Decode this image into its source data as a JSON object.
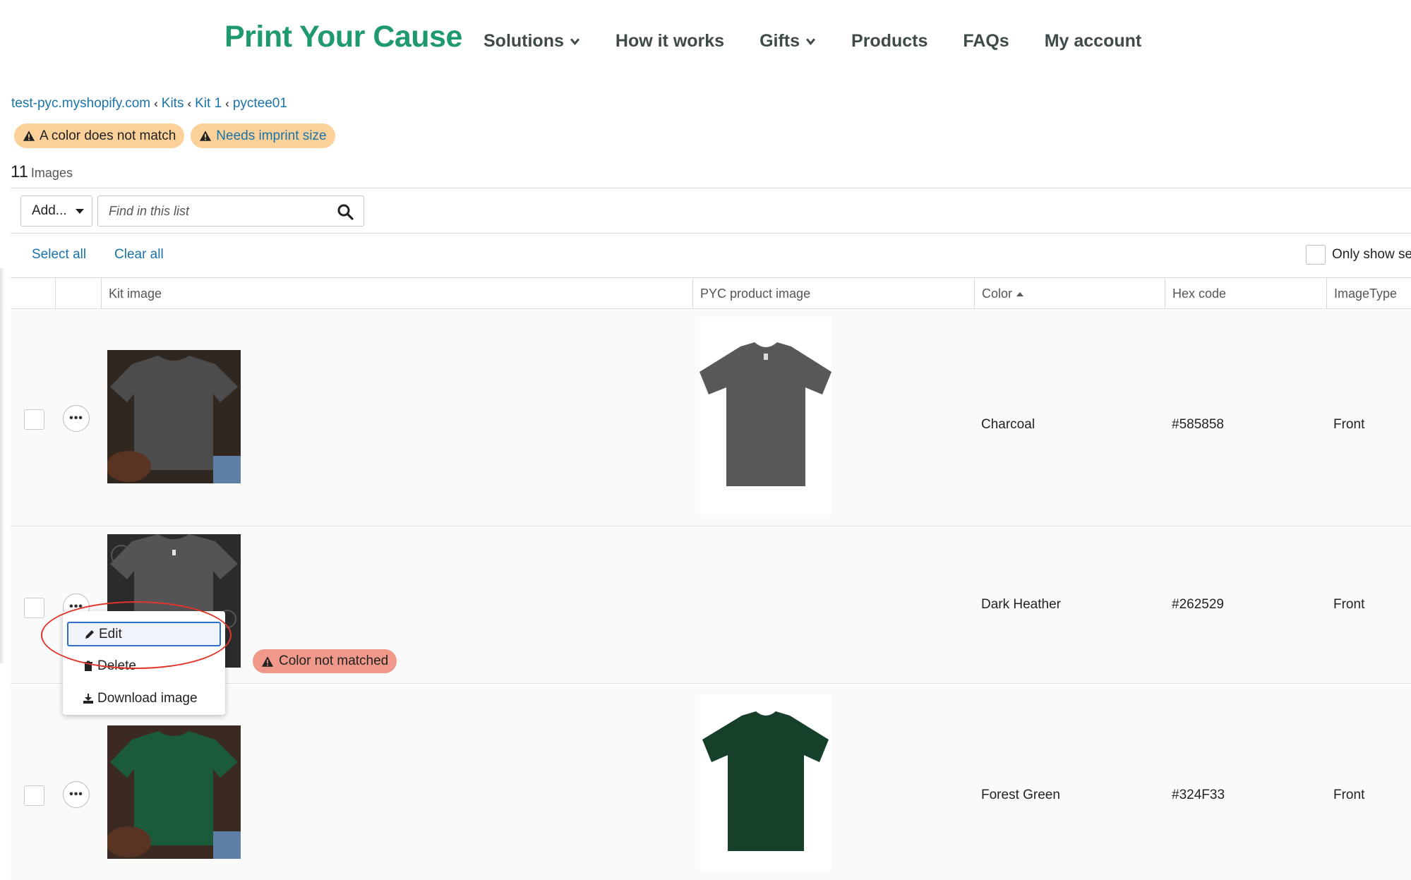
{
  "header": {
    "logo": "Print Your Cause",
    "nav": [
      {
        "label": "Solutions",
        "chevron": true
      },
      {
        "label": "How it works",
        "chevron": false
      },
      {
        "label": "Gifts",
        "chevron": true
      },
      {
        "label": "Products",
        "chevron": false
      },
      {
        "label": "FAQs",
        "chevron": false
      },
      {
        "label": "My account",
        "chevron": false
      }
    ]
  },
  "breadcrumb": [
    "test-pyc.myshopify.com",
    "Kits",
    "Kit 1",
    "pyctee01"
  ],
  "badges": [
    {
      "label": "A color does not match"
    },
    {
      "label": "Needs imprint size"
    }
  ],
  "summary": {
    "count": "11",
    "label": "Images"
  },
  "toolbar": {
    "add_label": "Add...",
    "search_placeholder": "Find in this list",
    "select_all": "Select all",
    "clear_all": "Clear all",
    "only_show": "Only show se"
  },
  "table": {
    "columns": [
      "Kit image",
      "PYC product image",
      "Color",
      "Hex code",
      "ImageType"
    ],
    "rows": [
      {
        "color": "Charcoal",
        "hex": "#585858",
        "type": "Front",
        "shirt": "#585856"
      },
      {
        "color": "Dark Heather",
        "hex": "#262529",
        "type": "Front",
        "warning": "Color not matched"
      },
      {
        "color": "Forest Green",
        "hex": "#324F33",
        "type": "Front",
        "shirt": "#17402b"
      }
    ]
  },
  "menu": {
    "items": [
      {
        "label": "Edit",
        "icon": "pencil-icon"
      },
      {
        "label": "Delete",
        "icon": "trash-icon"
      },
      {
        "label": "Download image",
        "icon": "download-icon"
      }
    ]
  },
  "colors": {
    "brand": "#1f9a6c",
    "link": "#1a73a8",
    "badge_bg": "#fbd199",
    "warning_bg": "#f0988a",
    "annotation": "#e0352b",
    "focus": "#2f6fc8"
  }
}
